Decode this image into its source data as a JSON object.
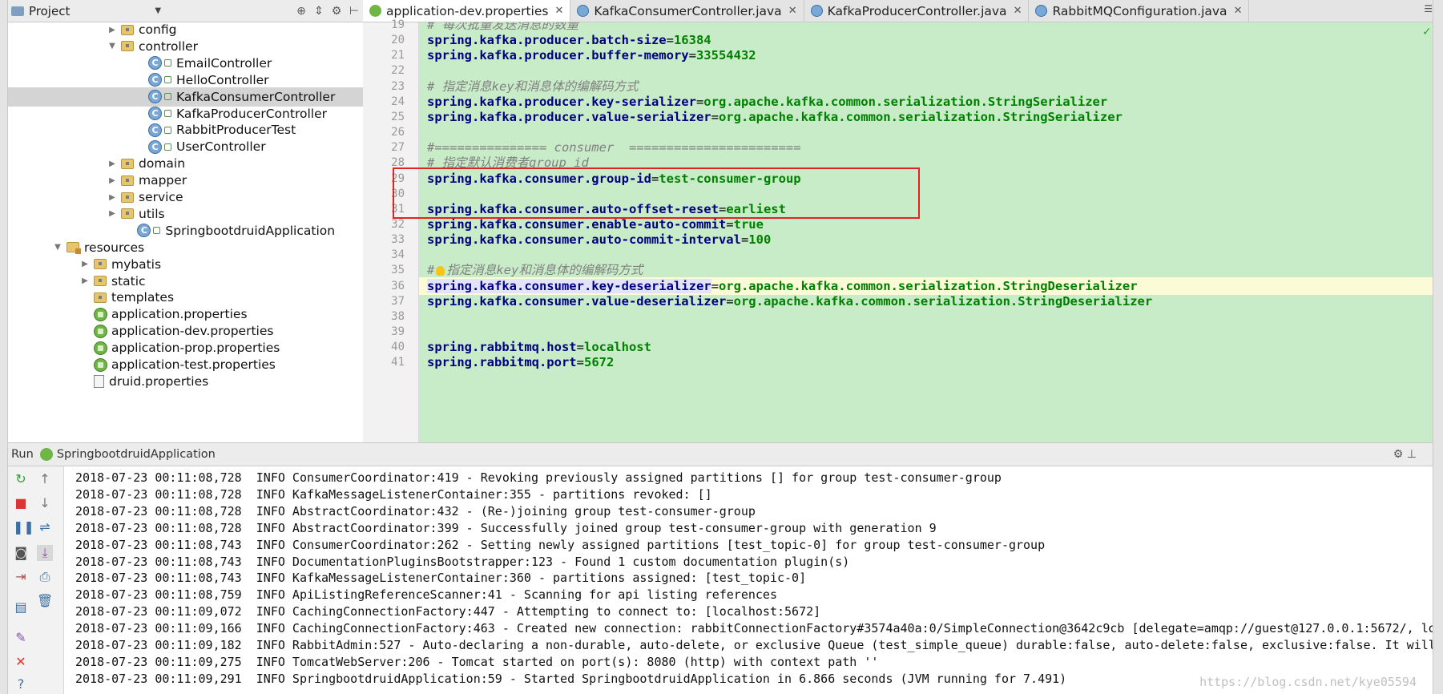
{
  "project_panel": {
    "title": "Project"
  },
  "tree": [
    {
      "label": "config",
      "kind": "folder",
      "indent": 1,
      "expanded": false
    },
    {
      "label": "controller",
      "kind": "folder",
      "indent": 1,
      "expanded": true
    },
    {
      "label": "EmailController",
      "kind": "class",
      "indent": 2
    },
    {
      "label": "HelloController",
      "kind": "class",
      "indent": 2
    },
    {
      "label": "KafkaConsumerController",
      "kind": "class",
      "indent": 2,
      "selected": true
    },
    {
      "label": "KafkaProducerController",
      "kind": "class",
      "indent": 2
    },
    {
      "label": "RabbitProducerTest",
      "kind": "class",
      "indent": 2
    },
    {
      "label": "UserController",
      "kind": "class",
      "indent": 2
    },
    {
      "label": "domain",
      "kind": "folder",
      "indent": 1,
      "expanded": false
    },
    {
      "label": "mapper",
      "kind": "folder",
      "indent": 1,
      "expanded": false
    },
    {
      "label": "service",
      "kind": "folder",
      "indent": 1,
      "expanded": false
    },
    {
      "label": "utils",
      "kind": "folder",
      "indent": 1,
      "expanded": false
    },
    {
      "label": "SpringbootdruidApplication",
      "kind": "class",
      "indent": 1.6
    },
    {
      "label": "resources",
      "kind": "resfolder",
      "indent": -1,
      "expanded": true
    },
    {
      "label": "mybatis",
      "kind": "folder",
      "indent": 0,
      "expanded": false
    },
    {
      "label": "static",
      "kind": "folder",
      "indent": 0,
      "expanded": false
    },
    {
      "label": "templates",
      "kind": "folder",
      "indent": 0,
      "noarrow": true
    },
    {
      "label": "application.properties",
      "kind": "props",
      "indent": 0
    },
    {
      "label": "application-dev.properties",
      "kind": "props",
      "indent": 0
    },
    {
      "label": "application-prop.properties",
      "kind": "props",
      "indent": 0
    },
    {
      "label": "application-test.properties",
      "kind": "props",
      "indent": 0
    },
    {
      "label": "druid.properties",
      "kind": "file",
      "indent": 0
    }
  ],
  "tabs": [
    {
      "label": "application-dev.properties",
      "kind": "props",
      "active": true
    },
    {
      "label": "KafkaConsumerController.java",
      "kind": "class"
    },
    {
      "label": "KafkaProducerController.java",
      "kind": "class"
    },
    {
      "label": "RabbitMQConfiguration.java",
      "kind": "class"
    }
  ],
  "editor": {
    "first_line_number": 19,
    "lines": [
      {
        "type": "comment",
        "text": "# 每次批量发送消息的数量"
      },
      {
        "type": "kv",
        "key": "spring.kafka.producer.batch-size",
        "value": "16384"
      },
      {
        "type": "kv",
        "key": "spring.kafka.producer.buffer-memory",
        "value": "33554432"
      },
      {
        "type": "blank"
      },
      {
        "type": "comment",
        "text": "# 指定消息key和消息体的编解码方式"
      },
      {
        "type": "kv",
        "key": "spring.kafka.producer.key-serializer",
        "value": "org.apache.kafka.common.serialization.StringSerializer"
      },
      {
        "type": "kv",
        "key": "spring.kafka.producer.value-serializer",
        "value": "org.apache.kafka.common.serialization.StringSerializer"
      },
      {
        "type": "blank"
      },
      {
        "type": "comment",
        "text": "#=============== consumer  ======================="
      },
      {
        "type": "comment",
        "text": "# 指定默认消费者group id"
      },
      {
        "type": "kv",
        "key": "spring.kafka.consumer.group-id",
        "value": "test-consumer-group"
      },
      {
        "type": "blank"
      },
      {
        "type": "kv",
        "key": "spring.kafka.consumer.auto-offset-reset",
        "value": "earliest"
      },
      {
        "type": "kv",
        "key": "spring.kafka.consumer.enable-auto-commit",
        "value": "true"
      },
      {
        "type": "kv",
        "key": "spring.kafka.consumer.auto-commit-interval",
        "value": "100"
      },
      {
        "type": "blank"
      },
      {
        "type": "comment",
        "text": "#指定消息key和消息体的编解码方式",
        "bulb": true
      },
      {
        "type": "kv",
        "key": "spring.kafka.consumer.key-deserializer",
        "value": "org.apache.kafka.common.serialization.StringDeserializer",
        "caret": true
      },
      {
        "type": "kv",
        "key": "spring.kafka.consumer.value-deserializer",
        "value": "org.apache.kafka.common.serialization.StringDeserializer"
      },
      {
        "type": "blank"
      },
      {
        "type": "blank"
      },
      {
        "type": "kv",
        "key": "spring.rabbitmq.host",
        "value": "localhost"
      },
      {
        "type": "kv",
        "key": "spring.rabbitmq.port",
        "value": "5672"
      }
    ]
  },
  "run": {
    "label": "Run",
    "app": "SpringbootdruidApplication"
  },
  "console": [
    "2018-07-23 00:11:08,728  INFO ConsumerCoordinator:419 - Revoking previously assigned partitions [] for group test-consumer-group",
    "2018-07-23 00:11:08,728  INFO KafkaMessageListenerContainer:355 - partitions revoked: []",
    "2018-07-23 00:11:08,728  INFO AbstractCoordinator:432 - (Re-)joining group test-consumer-group",
    "2018-07-23 00:11:08,728  INFO AbstractCoordinator:399 - Successfully joined group test-consumer-group with generation 9",
    "2018-07-23 00:11:08,743  INFO ConsumerCoordinator:262 - Setting newly assigned partitions [test_topic-0] for group test-consumer-group",
    "2018-07-23 00:11:08,743  INFO DocumentationPluginsBootstrapper:123 - Found 1 custom documentation plugin(s)",
    "2018-07-23 00:11:08,743  INFO KafkaMessageListenerContainer:360 - partitions assigned: [test_topic-0]",
    "2018-07-23 00:11:08,759  INFO ApiListingReferenceScanner:41 - Scanning for api listing references",
    "2018-07-23 00:11:09,072  INFO CachingConnectionFactory:447 - Attempting to connect to: [localhost:5672]",
    "2018-07-23 00:11:09,166  INFO CachingConnectionFactory:463 - Created new connection: rabbitConnectionFactory#3574a40a:0/SimpleConnection@3642c9cb [delegate=amqp://guest@127.0.0.1:5672/, lo",
    "2018-07-23 00:11:09,182  INFO RabbitAdmin:527 - Auto-declaring a non-durable, auto-delete, or exclusive Queue (test_simple_queue) durable:false, auto-delete:false, exclusive:false. It will",
    "2018-07-23 00:11:09,275  INFO TomcatWebServer:206 - Tomcat started on port(s): 8080 (http) with context path ''",
    "2018-07-23 00:11:09,291  INFO SpringbootdruidApplication:59 - Started SpringbootdruidApplication in 6.866 seconds (JVM running for 7.491)"
  ],
  "watermark": "https://blog.csdn.net/kye05594"
}
